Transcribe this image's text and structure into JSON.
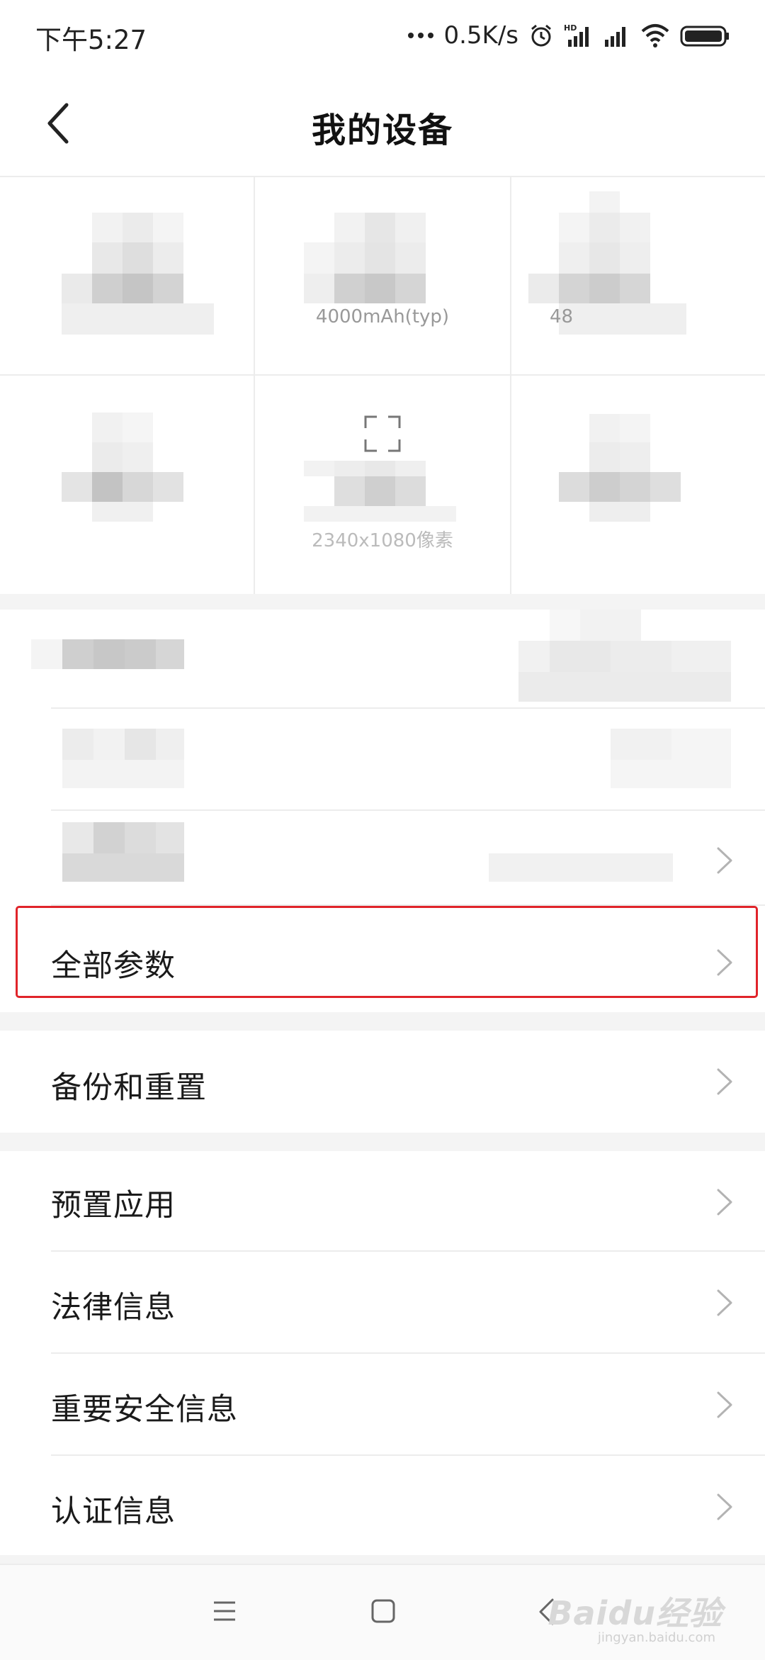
{
  "status": {
    "time": "下午5:27",
    "speed": "0.5K/s",
    "icons": [
      "more-dots-icon",
      "alarm-icon",
      "hd-signal-icon",
      "signal-icon",
      "wifi-icon",
      "battery-icon"
    ]
  },
  "header": {
    "title": "我的设备",
    "back_icon": "chevron-left-icon"
  },
  "specs": {
    "battery_value": "4000mAh(typ)",
    "camera_value_partial": "48",
    "screen_value": "2340x1080像素"
  },
  "list": {
    "all_params": "全部参数",
    "backup_reset": "备份和重置",
    "preinstalled_apps": "预置应用",
    "legal_info": "法律信息",
    "safety_info": "重要安全信息",
    "certification_info": "认证信息"
  },
  "navbar": {
    "menu_icon": "menu-icon",
    "home_icon": "home-square-icon",
    "back_icon": "back-triangle-icon"
  },
  "watermark": {
    "text": "Baidu经验",
    "sub": "jingyan.baidu.com"
  },
  "colors": {
    "highlight": "#e0242a",
    "divider": "#ececec",
    "band": "#f4f4f4"
  }
}
